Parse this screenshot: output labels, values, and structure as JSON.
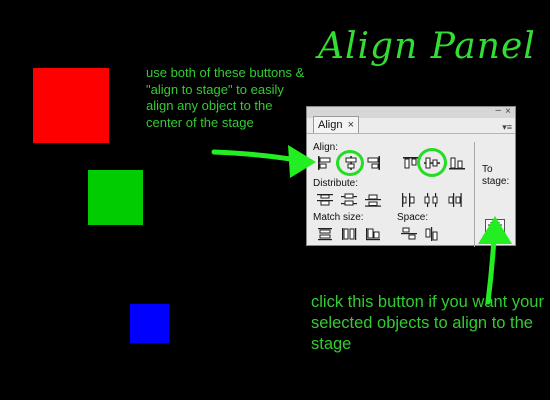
{
  "annotation": {
    "title": "Align Panel",
    "note_top": "use both of these buttons & \"align to stage\" to easily align any object to the center of the stage",
    "note_bottom": "click this button if you want your selected objects to align to the stage",
    "accent_color": "#33dd33"
  },
  "panel": {
    "tab_label": "Align",
    "tab_close": "×",
    "window_close": "×",
    "window_minimize": "–",
    "menu_icon": "▾≡",
    "sections": {
      "align": "Align:",
      "distribute": "Distribute:",
      "match_size": "Match size:",
      "space": "Space:",
      "to_stage": "To stage:"
    },
    "buttons": {
      "align": [
        "align-left",
        "align-horizontal-center",
        "align-right",
        "align-top",
        "align-vertical-center",
        "align-bottom"
      ],
      "distribute": [
        "distribute-top",
        "distribute-vertical-center",
        "distribute-bottom",
        "distribute-left",
        "distribute-horizontal-center",
        "distribute-right"
      ],
      "match_size": [
        "match-width",
        "match-height",
        "match-width-and-height"
      ],
      "space": [
        "space-evenly-vertically",
        "space-evenly-horizontally"
      ],
      "to_stage": "align-to-stage"
    }
  },
  "objects": [
    {
      "name": "red-square",
      "color": "#ff0000"
    },
    {
      "name": "green-square",
      "color": "#00cc00"
    },
    {
      "name": "blue-square",
      "color": "#0000ff"
    }
  ]
}
